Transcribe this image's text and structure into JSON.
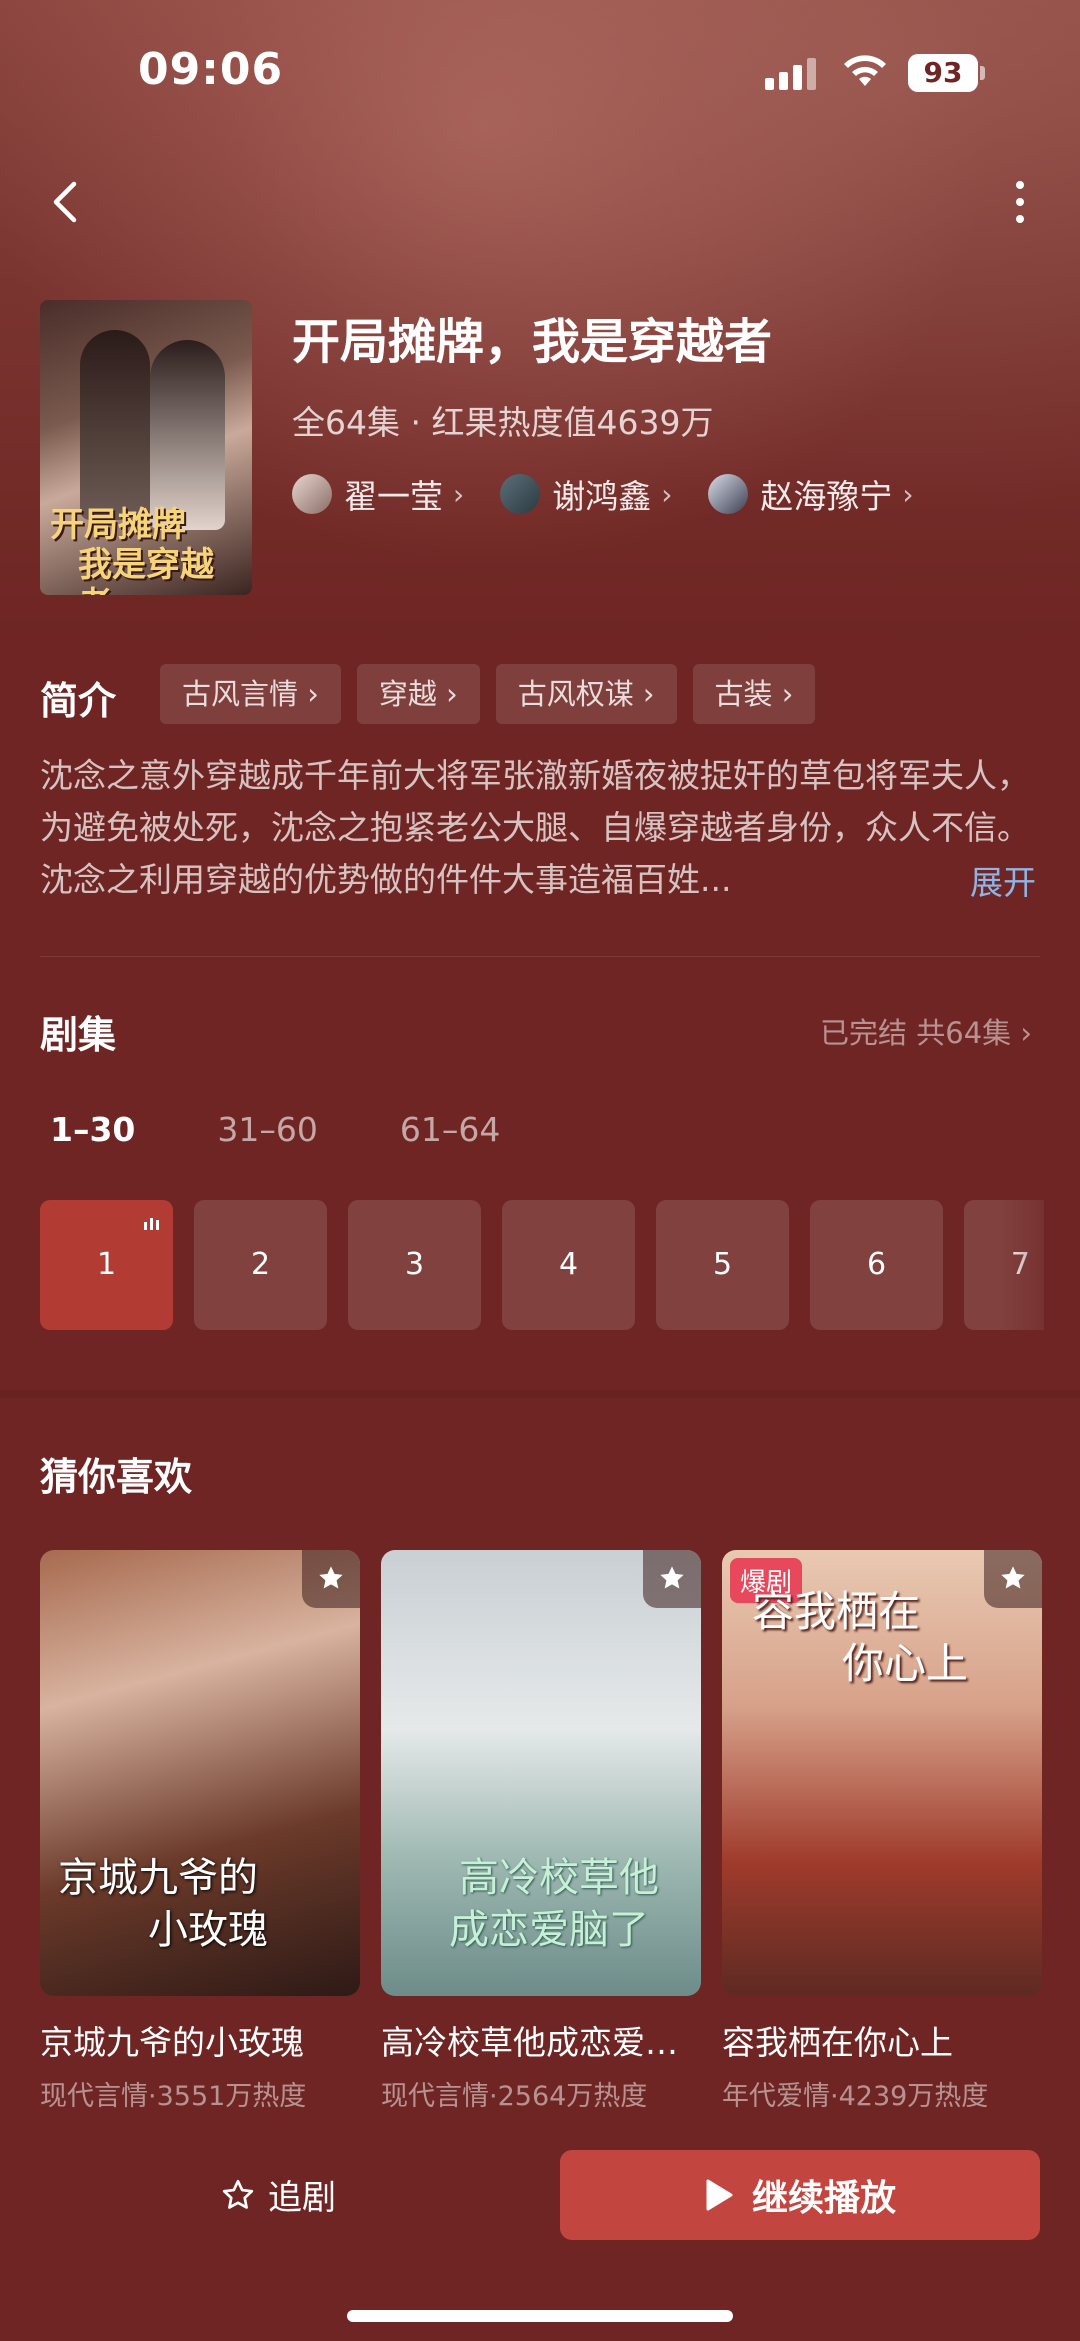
{
  "status_bar": {
    "time": "09:06",
    "battery": "93"
  },
  "show": {
    "title": "开局摊牌，我是穿越者",
    "meta": "全64集 · 红果热度值4639万",
    "poster_title_line1": "开局摊牌",
    "poster_title_line2": "我是穿越者",
    "cast": [
      {
        "name": "翟一莹"
      },
      {
        "name": "谢鸿鑫"
      },
      {
        "name": "赵海豫宁"
      }
    ]
  },
  "intro": {
    "label": "简介",
    "tags": [
      "古风言情",
      "穿越",
      "古风权谋",
      "古装"
    ],
    "description": "沈念之意外穿越成千年前大将军张澈新婚夜被捉奸的草包将军夫人，为避免被处死，沈念之抱紧老公大腿、自爆穿越者身份，众人不信。沈念之利用穿越的优势做的件件大事造福百姓...",
    "expand": "展开"
  },
  "episodes": {
    "title": "剧集",
    "status": "已完结 共64集",
    "ranges": [
      "1–30",
      "31–60",
      "61–64"
    ],
    "items": [
      "1",
      "2",
      "3",
      "4",
      "5",
      "6",
      "7"
    ]
  },
  "recommend": {
    "title": "猜你喜欢",
    "items": [
      {
        "name": "京城九爷的小玫瑰",
        "sub": "现代言情·3551万热度",
        "cover_line1": "京城九爷的",
        "cover_line2": "小玫瑰"
      },
      {
        "name": "高冷校草他成恋爱脑了",
        "sub": "高冷校草他成恋爱...",
        "sub_real": "高冷校草他成恋爱脑了",
        "genre": "现代言情·2564万热度",
        "cover_line1": "高冷校草他",
        "cover_line2": "成恋爱脑了"
      },
      {
        "name": "容我栖在你心上",
        "sub": "年代爱情·4239万热度",
        "badge": "爆剧",
        "cover_line1": "容我栖在",
        "cover_line2": "你心上"
      }
    ]
  },
  "actions": {
    "follow": "追剧",
    "continue": "继续播放"
  },
  "colors": {
    "background": "#6e2523",
    "accent": "#b23b34",
    "button": "#c2463f",
    "link": "#8fb4e6"
  }
}
